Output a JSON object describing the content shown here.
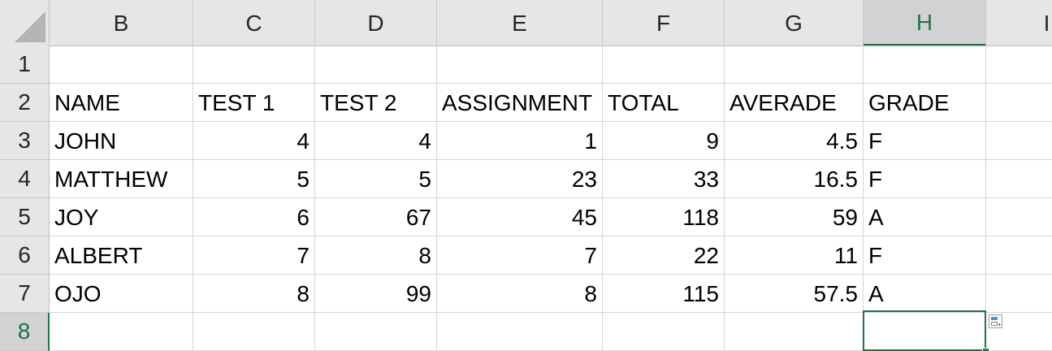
{
  "columns": [
    {
      "id": "B",
      "label": "B"
    },
    {
      "id": "C",
      "label": "C"
    },
    {
      "id": "D",
      "label": "D"
    },
    {
      "id": "E",
      "label": "E"
    },
    {
      "id": "F",
      "label": "F"
    },
    {
      "id": "G",
      "label": "G"
    },
    {
      "id": "H",
      "label": "H",
      "selected": true
    },
    {
      "id": "I",
      "label": "I"
    }
  ],
  "rows": [
    "1",
    "2",
    "3",
    "4",
    "5",
    "6",
    "7",
    "8"
  ],
  "selected_row": "8",
  "active_cell": "H8",
  "accent_color": "#217346",
  "table": {
    "headers": [
      "NAME",
      "TEST 1",
      "TEST 2",
      "ASSIGNMENT",
      "TOTAL",
      "AVERADE",
      "GRADE"
    ],
    "records": [
      [
        "JOHN",
        "4",
        "4",
        "1",
        "9",
        "4.5",
        "F"
      ],
      [
        "MATTHEW",
        "5",
        "5",
        "23",
        "33",
        "16.5",
        "F"
      ],
      [
        "JOY",
        "6",
        "67",
        "45",
        "118",
        "59",
        "A"
      ],
      [
        "ALBERT",
        "7",
        "8",
        "7",
        "22",
        "11",
        "F"
      ],
      [
        "OJO",
        "8",
        "99",
        "8",
        "115",
        "57.5",
        "A"
      ]
    ]
  },
  "icons": {
    "corner": "select-all-icon",
    "quick_analysis": "quick-analysis-icon"
  }
}
